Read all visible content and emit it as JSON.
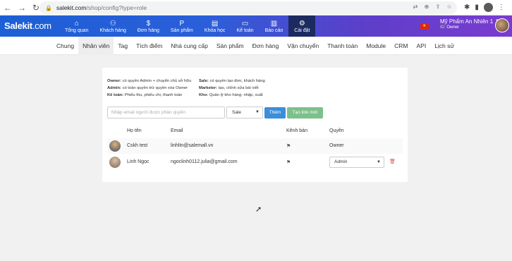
{
  "browser": {
    "url_host": "salekit.com",
    "url_path": "/shop/config?type=role"
  },
  "header": {
    "logo_main": "Salekit",
    "logo_suffix": ".com",
    "menu": [
      {
        "icon": "⌂",
        "label": "Tổng quan",
        "name": "home-icon"
      },
      {
        "icon": "⚇",
        "label": "Khách hàng",
        "name": "customers-icon"
      },
      {
        "icon": "$",
        "label": "Đơn hàng",
        "name": "orders-icon"
      },
      {
        "icon": "P",
        "label": "Sản phẩm",
        "name": "products-icon"
      },
      {
        "icon": "▤",
        "label": "Khóa học",
        "name": "courses-icon"
      },
      {
        "icon": "▭",
        "label": "Kế toán",
        "name": "accounting-icon"
      },
      {
        "icon": "▥",
        "label": "Báo cáo",
        "name": "reports-icon"
      },
      {
        "icon": "⚙",
        "label": "Cài đặt",
        "name": "gear-icon"
      }
    ],
    "user_name": "Mỹ Phẩm An Nhiên 1",
    "user_role": "Owner",
    "user_role_prefix": "ID:"
  },
  "subtabs": [
    "Chung",
    "Nhân viên",
    "Tag",
    "Tích điểm",
    "Nhà cung cấp",
    "Sản phẩm",
    "Đơn hàng",
    "Vận chuyển",
    "Thanh toán",
    "Module",
    "CRM",
    "API",
    "Lịch sử"
  ],
  "active_subtab": "Nhân viên",
  "roles_desc": {
    "owner_key": "Owner:",
    "owner_val": " có quyền Admin + chuyển chủ sở hữu",
    "admin_key": "Admin:",
    "admin_val": " có toàn quyền trừ quyền xóa Owner",
    "accountant_key": "Kế toán:",
    "accountant_val": " Phiếu thu, phiếu chi, thanh toán",
    "sale_key": "Sale:",
    "sale_val": " có quyền tạo đơn, khách hàng",
    "marketer_key": "Marketer:",
    "marketer_val": " tạo, chỉnh sửa bài viết",
    "warehouse_key": "Kho:",
    "warehouse_val": " Quản lý kho hàng: nhập, xuất"
  },
  "invite": {
    "placeholder": "Nhập email người được phân quyền",
    "selected_role": "Sale",
    "add_label": "Thêm",
    "create_link_label": "Tạo link mời"
  },
  "table": {
    "headers": {
      "name": "Họ tên",
      "email": "Email",
      "channel": "Kênh bán",
      "permission": "Quyền"
    },
    "rows": [
      {
        "name": "Cskh test",
        "email": "linhltn@salemall.vn",
        "permission": "Owner"
      },
      {
        "name": "Linh Ngọc",
        "email": "ngoclinh0112.julia@gmail.com",
        "permission": "Admin"
      }
    ]
  }
}
